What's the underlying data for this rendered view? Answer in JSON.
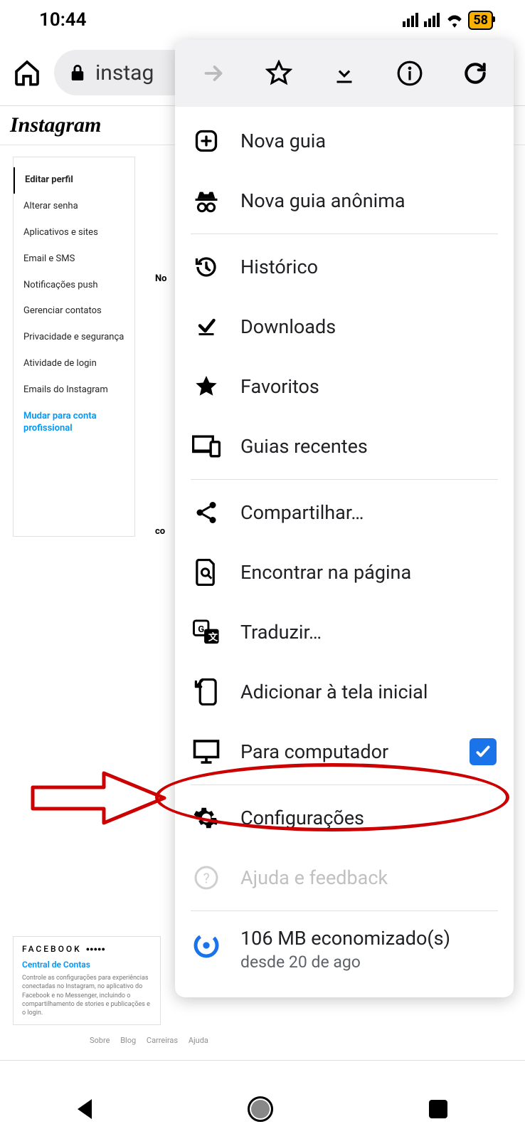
{
  "status": {
    "time": "10:44",
    "battery": "58"
  },
  "browser": {
    "url_text": "instag"
  },
  "instagram": {
    "logo": "Instagram",
    "sidebar": [
      "Editar perfil",
      "Alterar senha",
      "Aplicativos e sites",
      "Email e SMS",
      "Notificações push",
      "Gerenciar contatos",
      "Privacidade e segurança",
      "Atividade de login",
      "Emails do Instagram",
      "Mudar para conta profissional"
    ],
    "right_hint1": "No",
    "right_hint2": "co",
    "footer": {
      "brand": "FACEBOOK",
      "link": "Central de Contas",
      "desc": "Controle as configurações para experiências conectadas no Instagram, no aplicativo do Facebook e no Messenger, incluindo o compartilhamento de stories e publicações e o login."
    },
    "footer_links": [
      "Sobre",
      "Blog",
      "Carreiras",
      "Ajuda"
    ]
  },
  "menu": {
    "items": [
      "Nova guia",
      "Nova guia anônima",
      "Histórico",
      "Downloads",
      "Favoritos",
      "Guias recentes",
      "Compartilhar…",
      "Encontrar na página",
      "Traduzir…",
      "Adicionar à tela inicial",
      "Para computador",
      "Configurações",
      "Ajuda e feedback"
    ],
    "data_saver": {
      "main": "106 MB economizado(s)",
      "sub": "desde 20 de ago"
    }
  }
}
